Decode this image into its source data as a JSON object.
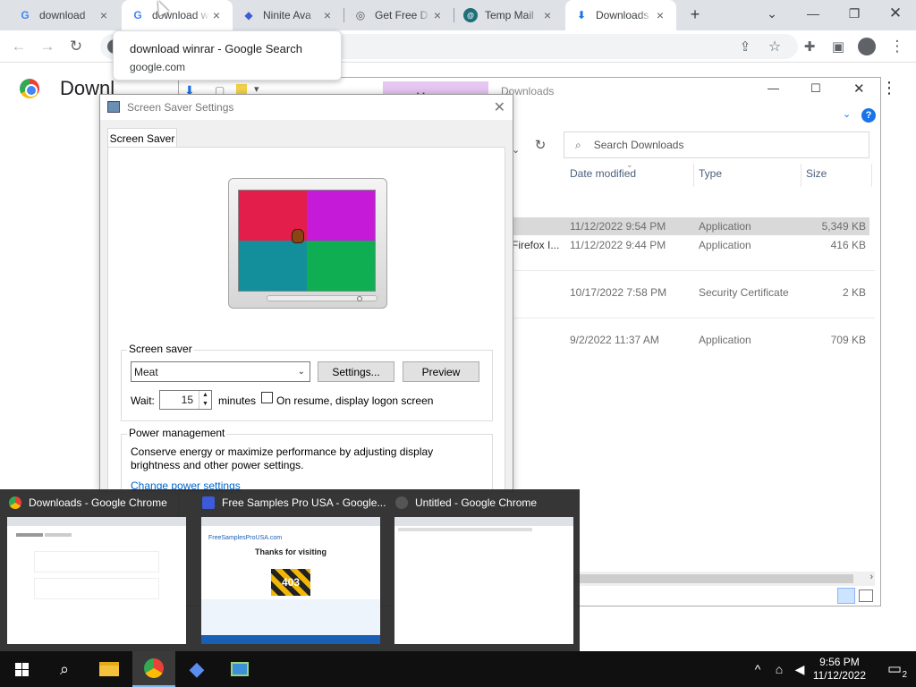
{
  "chrome": {
    "tabs": [
      {
        "title": "download",
        "icon": "google-g-icon"
      },
      {
        "title": "download w",
        "icon": "google-g-icon"
      },
      {
        "title": "Ninite Ava",
        "icon": "ninite-icon"
      },
      {
        "title": "Get Free D",
        "icon": "ghost-icon"
      },
      {
        "title": "Temp Mail",
        "icon": "tempmail-icon"
      },
      {
        "title": "Downloads",
        "icon": "download-icon"
      }
    ],
    "new_tab": "+",
    "suggestion": {
      "title": "download winrar - Google Search",
      "url": "google.com"
    },
    "page_title": "Downl"
  },
  "explorer": {
    "manage_tab": "Manage",
    "window_title": "Downloads",
    "search_placeholder": "Search Downloads",
    "columns": [
      "Date modified",
      "Type",
      "Size"
    ],
    "rows": [
      {
        "name": "",
        "date": "11/12/2022 9:54 PM",
        "type": "Application",
        "size": "5,349 KB"
      },
      {
        "name": "Firefox I...",
        "date": "11/12/2022 9:44 PM",
        "type": "Application",
        "size": "416 KB"
      },
      {
        "name": "",
        "date": "10/17/2022 7:58 PM",
        "type": "Security Certificate",
        "size": "2 KB"
      },
      {
        "name": "",
        "date": "9/2/2022 11:37 AM",
        "type": "Application",
        "size": "709 KB"
      }
    ]
  },
  "dialog": {
    "title": "Screen Saver Settings",
    "tab": "Screen Saver",
    "screensaver_group": "Screen saver",
    "selected_saver": "Meat",
    "settings_btn": "Settings...",
    "preview_btn": "Preview",
    "wait_label": "Wait:",
    "wait_value": "15",
    "minutes_label": "minutes",
    "resume_label": "On resume, display logon screen",
    "power_group": "Power management",
    "power_text": "Conserve energy or maximize performance by adjusting display brightness and other power settings.",
    "power_link": "Change power settings",
    "colors": {
      "q1": "#e31e4a",
      "q2": "#c51ad8",
      "q3": "#138f9c",
      "q4": "#0fae52"
    }
  },
  "thumbnails": [
    {
      "title": "Downloads - Google Chrome"
    },
    {
      "title": "Free Samples Pro USA - Google..."
    },
    {
      "title": "Untitled - Google Chrome"
    }
  ],
  "thumb_content": {
    "site": "FreeSamplesProUSA.com",
    "heading": "Thanks for visiting",
    "code": "403"
  },
  "taskbar": {
    "time": "9:56 PM",
    "date": "11/12/2022",
    "notifications": "2"
  }
}
